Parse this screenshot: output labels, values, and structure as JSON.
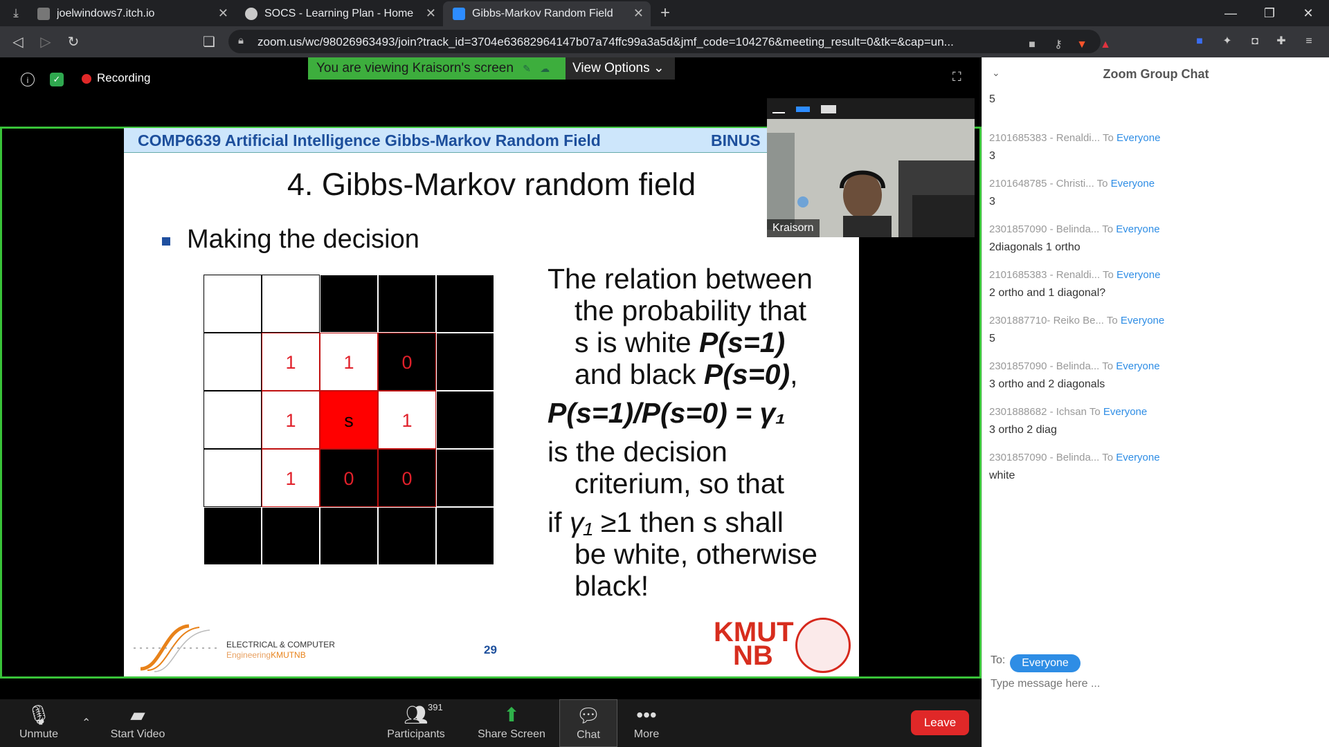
{
  "browser": {
    "tabs": [
      {
        "title": "joelwindows7.itch.io",
        "active": false
      },
      {
        "title": "SOCS - Learning Plan - Home",
        "active": false
      },
      {
        "title": "Gibbs-Markov Random Field",
        "active": true
      }
    ],
    "url": "zoom.us/wc/98026963493/join?track_id=3704e63682964147b07a74ffc99a3a5d&jmf_code=104276&meeting_result=0&tk=&cap=un..."
  },
  "zoom": {
    "recording_label": "Recording",
    "viewing_banner": "You are viewing Kraisorn's screen",
    "view_options_label": "View Options",
    "video_name": "Kraisorn",
    "toolbar": {
      "unmute": "Unmute",
      "start_video": "Start Video",
      "participants": "Participants",
      "participants_count": "391",
      "share_screen": "Share Screen",
      "chat": "Chat",
      "more": "More",
      "leave": "Leave"
    }
  },
  "slide": {
    "course": "COMP6639 Artificial Intelligence Gibbs-Markov Random Field",
    "institution": "BINUS",
    "title": "4. Gibbs-Markov random field",
    "bullet": "Making the decision",
    "grid": [
      [
        {
          "c": "white",
          "t": ""
        },
        {
          "c": "white",
          "t": ""
        },
        {
          "c": "black",
          "t": ""
        },
        {
          "c": "black",
          "t": ""
        },
        {
          "c": "black",
          "t": ""
        }
      ],
      [
        {
          "c": "white",
          "t": ""
        },
        {
          "c": "white",
          "t": "1",
          "red": true
        },
        {
          "c": "white",
          "t": "1",
          "red": true
        },
        {
          "c": "black",
          "t": "0",
          "red": true
        },
        {
          "c": "black",
          "t": ""
        }
      ],
      [
        {
          "c": "white",
          "t": ""
        },
        {
          "c": "white",
          "t": "1",
          "red": true
        },
        {
          "c": "red",
          "t": "s",
          "red": true
        },
        {
          "c": "white",
          "t": "1",
          "red": true
        },
        {
          "c": "black",
          "t": ""
        }
      ],
      [
        {
          "c": "white",
          "t": ""
        },
        {
          "c": "white",
          "t": "1",
          "red": true
        },
        {
          "c": "black",
          "t": "0",
          "red": true
        },
        {
          "c": "black",
          "t": "0",
          "red": true
        },
        {
          "c": "black",
          "t": ""
        }
      ],
      [
        {
          "c": "black",
          "t": ""
        },
        {
          "c": "black",
          "t": ""
        },
        {
          "c": "black",
          "t": ""
        },
        {
          "c": "black",
          "t": ""
        },
        {
          "c": "black",
          "t": ""
        }
      ]
    ],
    "relation": {
      "line1": "The relation between",
      "line2": "the probability that",
      "line3_a": "s is white ",
      "line3_b": "P(s=1)",
      "line4_a": "and black ",
      "line4_b": "P(s=0)",
      "line4_c": ",",
      "formula": "P(s=1)/P(s=0) = γ₁",
      "line5": "is the decision",
      "line6": "criterium, so that",
      "line7_a": "if ",
      "line7_b": "γ₁",
      "line7_c": " ≥1 then s shall",
      "line8": "be white, otherwise",
      "line9": "black!"
    },
    "dept_line1": "ELECTRICAL & COMPUTER",
    "dept_line2a": "Engineering",
    "dept_line2b": "KMUTNB",
    "page": "29",
    "kmutnb_1": "KMUT",
    "kmutnb_2": "NB"
  },
  "chat": {
    "title": "Zoom Group Chat",
    "first_text": "5",
    "messages": [
      {
        "sender": "2101685383 - Renaldi...",
        "to": "To",
        "target": "Everyone",
        "text": "3"
      },
      {
        "sender": "2101648785 - Christi...",
        "to": "To",
        "target": "Everyone",
        "text": "3"
      },
      {
        "sender": "2301857090 - Belinda...",
        "to": "To",
        "target": "Everyone",
        "text": "2diagonals 1 ortho"
      },
      {
        "sender": "2101685383 - Renaldi...",
        "to": "To",
        "target": "Everyone",
        "text": "2 ortho and 1 diagonal?"
      },
      {
        "sender": "2301887710- Reiko Be...",
        "to": "To",
        "target": "Everyone",
        "text": "5"
      },
      {
        "sender": "2301857090 - Belinda...",
        "to": "To",
        "target": "Everyone",
        "text": "3 ortho and 2 diagonals"
      },
      {
        "sender": "2301888682 - Ichsan",
        "to": "To",
        "target": "Everyone",
        "text": "3 ortho 2 diag"
      },
      {
        "sender": "2301857090 - Belinda...",
        "to": "To",
        "target": "Everyone",
        "text": "white"
      }
    ],
    "to_label": "To:",
    "recipient": "Everyone",
    "input_placeholder": "Type message here ..."
  }
}
